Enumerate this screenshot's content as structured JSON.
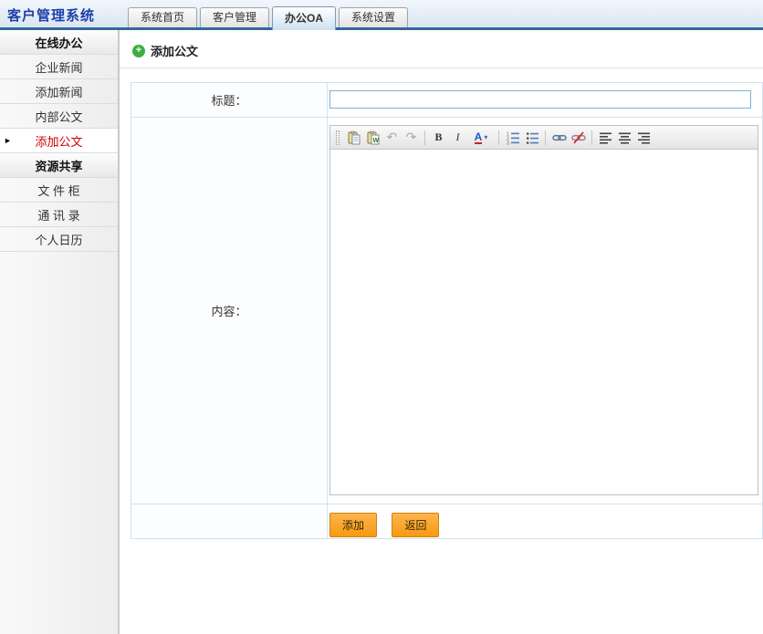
{
  "app": {
    "title": "客户管理系统"
  },
  "tabs": {
    "items": [
      {
        "label": "系统首页"
      },
      {
        "label": "客户管理"
      },
      {
        "label": "办公OA"
      },
      {
        "label": "系统设置"
      }
    ],
    "active": "办公OA"
  },
  "sidebar": {
    "sections": [
      {
        "header": "在线办公",
        "items": [
          {
            "label": "企业新闻"
          },
          {
            "label": "添加新闻"
          },
          {
            "label": "内部公文"
          },
          {
            "label": "添加公文",
            "active": true
          }
        ]
      },
      {
        "header": "资源共享",
        "items": [
          {
            "label": "文 件 柜"
          },
          {
            "label": "通 讯 录"
          },
          {
            "label": "个人日历"
          }
        ]
      }
    ],
    "active_item": "添加公文",
    "active_marker": "►"
  },
  "main": {
    "page_title": "添加公文",
    "plus_glyph": "+",
    "form": {
      "title_label": "标题：",
      "title_value": "",
      "content_label": "内容：",
      "add_button": "添加",
      "back_button": "返回"
    },
    "editor": {
      "toolbar_icons": [
        "paste-icon",
        "paste-word-icon",
        "undo-icon",
        "redo-icon",
        "bold-icon",
        "italic-icon",
        "font-color-icon",
        "ordered-list-icon",
        "unordered-list-icon",
        "link-icon",
        "unlink-icon",
        "align-left-icon",
        "align-center-icon",
        "align-right-icon"
      ],
      "bold_glyph": "B",
      "italic_glyph": "I",
      "font_glyph": "A",
      "caret_glyph": "▾",
      "undo_glyph": "↶",
      "redo_glyph": "↷",
      "content_value": ""
    }
  },
  "colors": {
    "header_strip": "#35679a",
    "title_text": "#1e41a7",
    "active_sidebar_text": "#cc0000",
    "button_orange": "#f79a10",
    "form_border": "#cfe2ee",
    "plus_icon_green": "#3fae3f"
  }
}
